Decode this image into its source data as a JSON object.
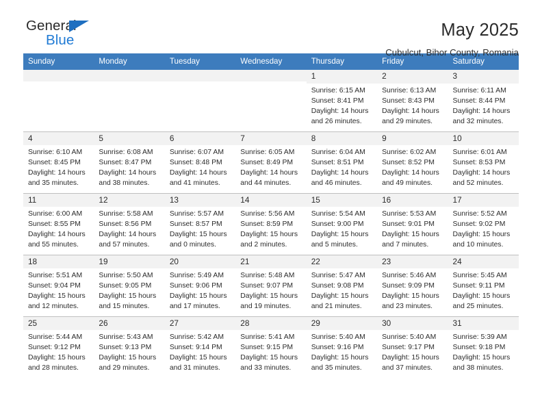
{
  "brand": {
    "name_top": "General",
    "name_bottom": "Blue",
    "triangle_icon": "triangle-icon",
    "accent_color": "#1f7ad4"
  },
  "header": {
    "title": "May 2025",
    "location": "Cubulcut, Bihor County, Romania"
  },
  "calendar": {
    "header_color": "#3d7cbd",
    "weekday_headers": [
      "Sunday",
      "Monday",
      "Tuesday",
      "Wednesday",
      "Thursday",
      "Friday",
      "Saturday"
    ],
    "weeks": [
      [
        {
          "day": "",
          "blank": true
        },
        {
          "day": "",
          "blank": true
        },
        {
          "day": "",
          "blank": true
        },
        {
          "day": "",
          "blank": true
        },
        {
          "day": "1",
          "sunrise": "Sunrise: 6:15 AM",
          "sunset": "Sunset: 8:41 PM",
          "daylight": "Daylight: 14 hours and 26 minutes."
        },
        {
          "day": "2",
          "sunrise": "Sunrise: 6:13 AM",
          "sunset": "Sunset: 8:43 PM",
          "daylight": "Daylight: 14 hours and 29 minutes."
        },
        {
          "day": "3",
          "sunrise": "Sunrise: 6:11 AM",
          "sunset": "Sunset: 8:44 PM",
          "daylight": "Daylight: 14 hours and 32 minutes."
        }
      ],
      [
        {
          "day": "4",
          "sunrise": "Sunrise: 6:10 AM",
          "sunset": "Sunset: 8:45 PM",
          "daylight": "Daylight: 14 hours and 35 minutes."
        },
        {
          "day": "5",
          "sunrise": "Sunrise: 6:08 AM",
          "sunset": "Sunset: 8:47 PM",
          "daylight": "Daylight: 14 hours and 38 minutes."
        },
        {
          "day": "6",
          "sunrise": "Sunrise: 6:07 AM",
          "sunset": "Sunset: 8:48 PM",
          "daylight": "Daylight: 14 hours and 41 minutes."
        },
        {
          "day": "7",
          "sunrise": "Sunrise: 6:05 AM",
          "sunset": "Sunset: 8:49 PM",
          "daylight": "Daylight: 14 hours and 44 minutes."
        },
        {
          "day": "8",
          "sunrise": "Sunrise: 6:04 AM",
          "sunset": "Sunset: 8:51 PM",
          "daylight": "Daylight: 14 hours and 46 minutes."
        },
        {
          "day": "9",
          "sunrise": "Sunrise: 6:02 AM",
          "sunset": "Sunset: 8:52 PM",
          "daylight": "Daylight: 14 hours and 49 minutes."
        },
        {
          "day": "10",
          "sunrise": "Sunrise: 6:01 AM",
          "sunset": "Sunset: 8:53 PM",
          "daylight": "Daylight: 14 hours and 52 minutes."
        }
      ],
      [
        {
          "day": "11",
          "sunrise": "Sunrise: 6:00 AM",
          "sunset": "Sunset: 8:55 PM",
          "daylight": "Daylight: 14 hours and 55 minutes."
        },
        {
          "day": "12",
          "sunrise": "Sunrise: 5:58 AM",
          "sunset": "Sunset: 8:56 PM",
          "daylight": "Daylight: 14 hours and 57 minutes."
        },
        {
          "day": "13",
          "sunrise": "Sunrise: 5:57 AM",
          "sunset": "Sunset: 8:57 PM",
          "daylight": "Daylight: 15 hours and 0 minutes."
        },
        {
          "day": "14",
          "sunrise": "Sunrise: 5:56 AM",
          "sunset": "Sunset: 8:59 PM",
          "daylight": "Daylight: 15 hours and 2 minutes."
        },
        {
          "day": "15",
          "sunrise": "Sunrise: 5:54 AM",
          "sunset": "Sunset: 9:00 PM",
          "daylight": "Daylight: 15 hours and 5 minutes."
        },
        {
          "day": "16",
          "sunrise": "Sunrise: 5:53 AM",
          "sunset": "Sunset: 9:01 PM",
          "daylight": "Daylight: 15 hours and 7 minutes."
        },
        {
          "day": "17",
          "sunrise": "Sunrise: 5:52 AM",
          "sunset": "Sunset: 9:02 PM",
          "daylight": "Daylight: 15 hours and 10 minutes."
        }
      ],
      [
        {
          "day": "18",
          "sunrise": "Sunrise: 5:51 AM",
          "sunset": "Sunset: 9:04 PM",
          "daylight": "Daylight: 15 hours and 12 minutes."
        },
        {
          "day": "19",
          "sunrise": "Sunrise: 5:50 AM",
          "sunset": "Sunset: 9:05 PM",
          "daylight": "Daylight: 15 hours and 15 minutes."
        },
        {
          "day": "20",
          "sunrise": "Sunrise: 5:49 AM",
          "sunset": "Sunset: 9:06 PM",
          "daylight": "Daylight: 15 hours and 17 minutes."
        },
        {
          "day": "21",
          "sunrise": "Sunrise: 5:48 AM",
          "sunset": "Sunset: 9:07 PM",
          "daylight": "Daylight: 15 hours and 19 minutes."
        },
        {
          "day": "22",
          "sunrise": "Sunrise: 5:47 AM",
          "sunset": "Sunset: 9:08 PM",
          "daylight": "Daylight: 15 hours and 21 minutes."
        },
        {
          "day": "23",
          "sunrise": "Sunrise: 5:46 AM",
          "sunset": "Sunset: 9:09 PM",
          "daylight": "Daylight: 15 hours and 23 minutes."
        },
        {
          "day": "24",
          "sunrise": "Sunrise: 5:45 AM",
          "sunset": "Sunset: 9:11 PM",
          "daylight": "Daylight: 15 hours and 25 minutes."
        }
      ],
      [
        {
          "day": "25",
          "sunrise": "Sunrise: 5:44 AM",
          "sunset": "Sunset: 9:12 PM",
          "daylight": "Daylight: 15 hours and 28 minutes."
        },
        {
          "day": "26",
          "sunrise": "Sunrise: 5:43 AM",
          "sunset": "Sunset: 9:13 PM",
          "daylight": "Daylight: 15 hours and 29 minutes."
        },
        {
          "day": "27",
          "sunrise": "Sunrise: 5:42 AM",
          "sunset": "Sunset: 9:14 PM",
          "daylight": "Daylight: 15 hours and 31 minutes."
        },
        {
          "day": "28",
          "sunrise": "Sunrise: 5:41 AM",
          "sunset": "Sunset: 9:15 PM",
          "daylight": "Daylight: 15 hours and 33 minutes."
        },
        {
          "day": "29",
          "sunrise": "Sunrise: 5:40 AM",
          "sunset": "Sunset: 9:16 PM",
          "daylight": "Daylight: 15 hours and 35 minutes."
        },
        {
          "day": "30",
          "sunrise": "Sunrise: 5:40 AM",
          "sunset": "Sunset: 9:17 PM",
          "daylight": "Daylight: 15 hours and 37 minutes."
        },
        {
          "day": "31",
          "sunrise": "Sunrise: 5:39 AM",
          "sunset": "Sunset: 9:18 PM",
          "daylight": "Daylight: 15 hours and 38 minutes."
        }
      ]
    ]
  }
}
